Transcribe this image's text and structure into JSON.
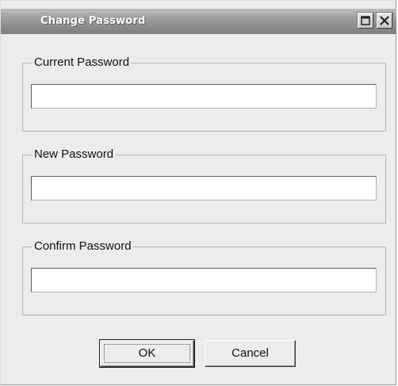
{
  "window": {
    "title": "Change Password"
  },
  "titlebar_buttons": {
    "maximize_icon": "maximize-icon",
    "close_icon": "close-icon"
  },
  "groups": {
    "current": {
      "label": "Current Password",
      "value": ""
    },
    "new": {
      "label": "New Password",
      "value": ""
    },
    "confirm": {
      "label": "Confirm Password",
      "value": ""
    }
  },
  "buttons": {
    "ok_label": "OK",
    "cancel_label": "Cancel"
  }
}
